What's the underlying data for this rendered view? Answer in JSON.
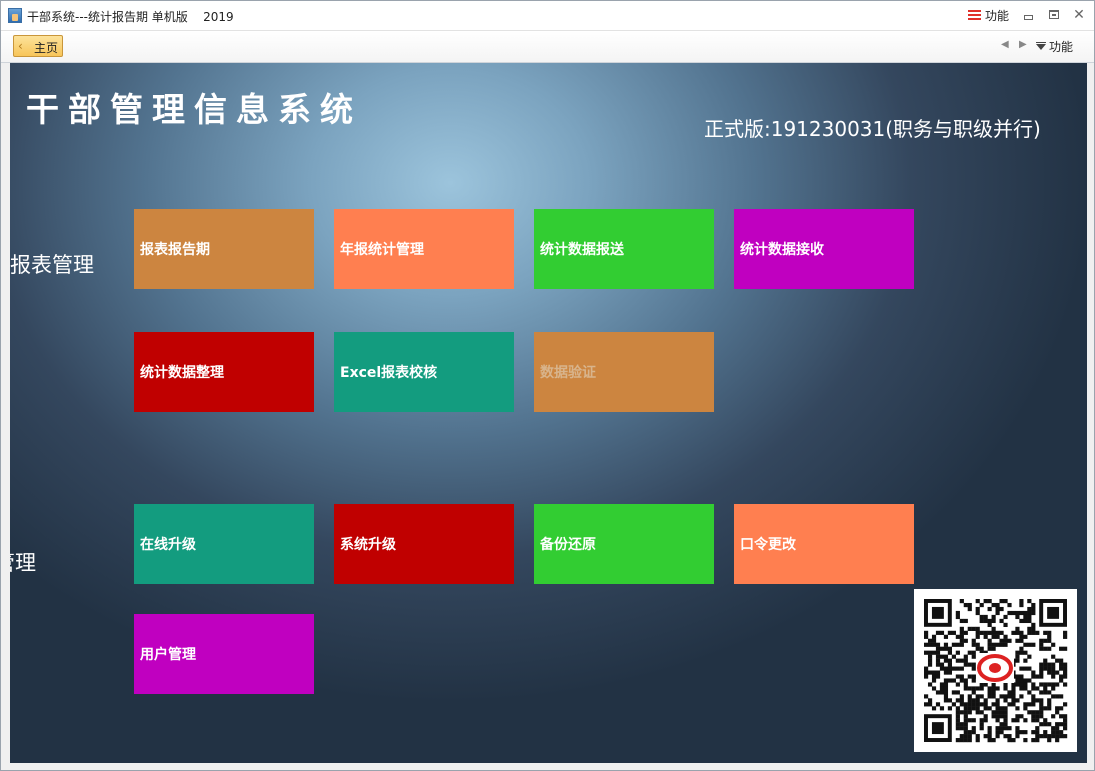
{
  "window": {
    "title": "干部系统---统计报告期 单机版    2019",
    "func_label": "功能",
    "close_glyph": "✕"
  },
  "tabbar": {
    "home_tab": "主页",
    "func_label": "功能",
    "left_arrow": "◀",
    "right_arrow": "▶"
  },
  "main": {
    "system_title": "干部管理信息系统",
    "version_text": "正式版:191230031(职务与职级并行)",
    "sections": [
      {
        "label": "报表管理",
        "tiles": [
          {
            "label": "报表报告期",
            "color": "#cc8540"
          },
          {
            "label": "年报统计管理",
            "color": "#ff7f50"
          },
          {
            "label": "统计数据报送",
            "color": "#32cd32"
          },
          {
            "label": "统计数据接收",
            "color": "#c000c0"
          },
          {
            "label": "统计数据整理",
            "color": "#c00000"
          },
          {
            "label": "Excel报表校核",
            "color": "#139c7f"
          },
          {
            "label": "数据验证",
            "color": "#cc8540",
            "disabled": true
          }
        ]
      },
      {
        "label": "管理",
        "tiles": [
          {
            "label": "在线升级",
            "color": "#139c7f"
          },
          {
            "label": "系统升级",
            "color": "#c00000"
          },
          {
            "label": "备份还原",
            "color": "#32cd32"
          },
          {
            "label": "口令更改",
            "color": "#ff7f50"
          },
          {
            "label": "用户管理",
            "color": "#c000c0"
          }
        ]
      }
    ]
  }
}
